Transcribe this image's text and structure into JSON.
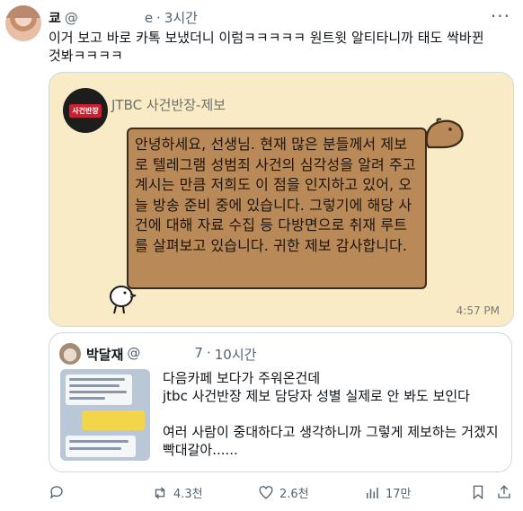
{
  "author": {
    "name": "쿄",
    "handle_prefix": "@",
    "handle_suffix": "e",
    "separator": "·",
    "time": "3시간"
  },
  "tweet_text": "이거 보고 바로 카톡 보냈더니 이럼ㅋㅋㅋㅋㅋ 원트윗 알티타니까 태도 싹바뀐 것봐ㅋㅋㅋㅋ",
  "chat_card": {
    "logo_text": "사건반장",
    "channel_name": "JTBC 사건반장-제보",
    "message": "안녕하세요, 선생님. 현재 많은 분들께서 제보로 텔레그램 성범죄 사건의 심각성을 알려 주고 계시는 만큼 저희도 이 점을 인지하고 있어, 오늘 방송 준비 중에 있습니다. 그렇기에 해당 사건에 대해 자료 수집 등 다방면으로 취재 루트를 살펴보고 있습니다. 귀한 제보 감사합니다.",
    "time": "4:57 PM"
  },
  "quote": {
    "name": "박달재",
    "handle_prefix": "@",
    "handle_suffix": "7",
    "separator": "·",
    "time": "10시간",
    "lines": [
      "다음카페 보다가 주워온건데",
      "jtbc 사건반장 제보 담당자 성별 실제로 안 봐도 보인다",
      "여러 사람이 중대하다고 생각하니까 그렇게 제보하는 거겠지 빡대갈아......"
    ]
  },
  "actions": {
    "retweets": "4.3천",
    "likes": "2.6천",
    "views": "17만"
  },
  "colors": {
    "accent_text": "#0f1419",
    "muted": "#536471",
    "card_bg": "#f9ebc5",
    "bubble": "#b98957"
  }
}
